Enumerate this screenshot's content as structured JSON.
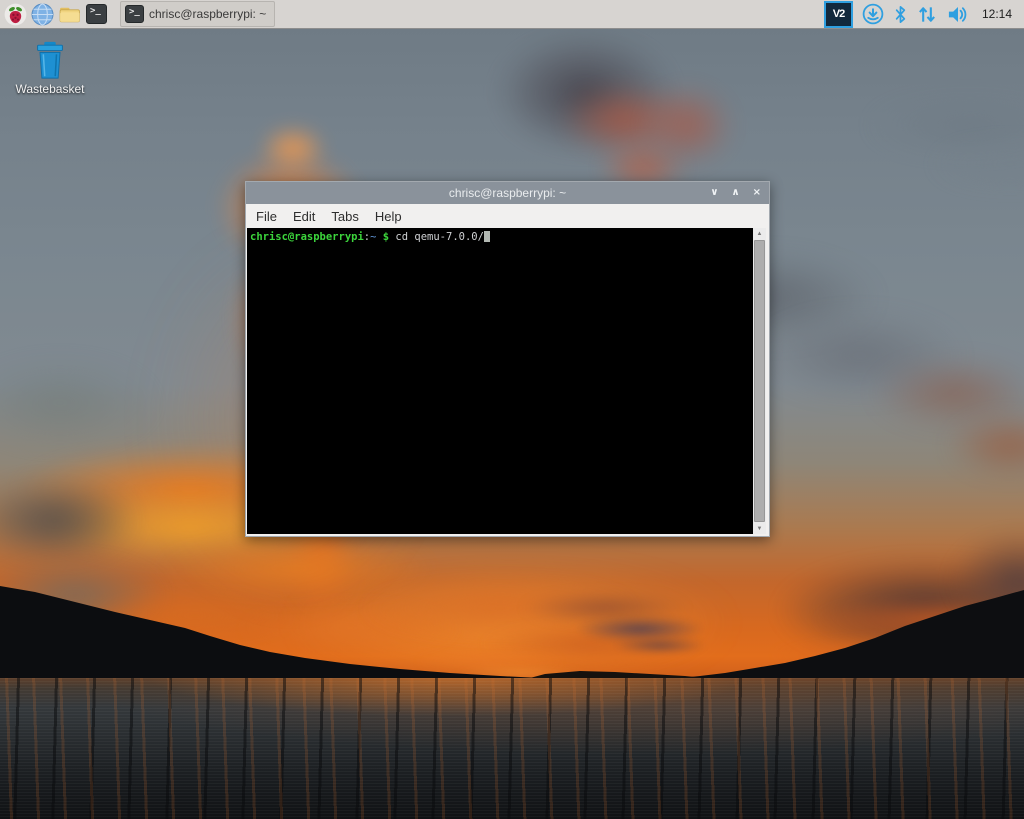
{
  "taskbar": {
    "launchers": [
      {
        "name": "menu",
        "icon": "raspberry-icon"
      },
      {
        "name": "web-browser",
        "icon": "globe-icon"
      },
      {
        "name": "file-manager",
        "icon": "folder-icon"
      },
      {
        "name": "terminal",
        "icon": "terminal-icon"
      }
    ],
    "terminal_icon_glyph": ">_",
    "window_button": {
      "icon": "terminal-icon",
      "label": "chrisc@raspberrypi: ~"
    },
    "tray": {
      "vnc_text": "V2",
      "clock": "12:14"
    }
  },
  "desktop": {
    "wastebasket_label": "Wastebasket"
  },
  "window": {
    "title": "chrisc@raspberrypi: ~",
    "controls": {
      "minimize": "∨",
      "maximize": "∧",
      "close": "×"
    },
    "menu": [
      {
        "label": "File"
      },
      {
        "label": "Edit"
      },
      {
        "label": "Tabs"
      },
      {
        "label": "Help"
      }
    ],
    "terminal": {
      "prompt_user_host": "chrisc@raspberrypi",
      "prompt_separator": ":",
      "prompt_path": "~",
      "prompt_symbol": " $ ",
      "command": "cd qemu-7.0.0/"
    }
  },
  "colors": {
    "taskbar_bg": "#d7d4d1",
    "tray_icon_blue": "#2f9fe0",
    "titlebar_bg": "#8a929b",
    "terminal_bg": "#000000",
    "terminal_green": "#3cd53c",
    "terminal_blue": "#6197d8",
    "terminal_fg": "#d0d2d4"
  }
}
